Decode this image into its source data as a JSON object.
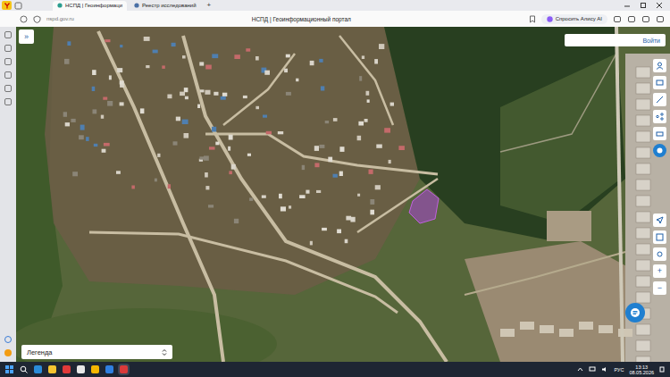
{
  "browser": {
    "tabs": [
      {
        "label": "НСПД | Геоинформаци",
        "selected": true
      },
      {
        "label": "Реестр исследований",
        "selected": false
      }
    ],
    "new_tab": "+",
    "address": "nspd.gov.ru",
    "page_title": "НСПД | Геоинформационный портал",
    "alice_button": "Спросить Алису AI"
  },
  "map": {
    "expand_button": "»",
    "login_button": "Войти",
    "legend": {
      "label": "Легенда"
    },
    "zoom": [
      "+",
      "−"
    ]
  },
  "taskbar": {
    "language": "РУС",
    "time": "13:13",
    "date": "08.05.2026"
  }
}
